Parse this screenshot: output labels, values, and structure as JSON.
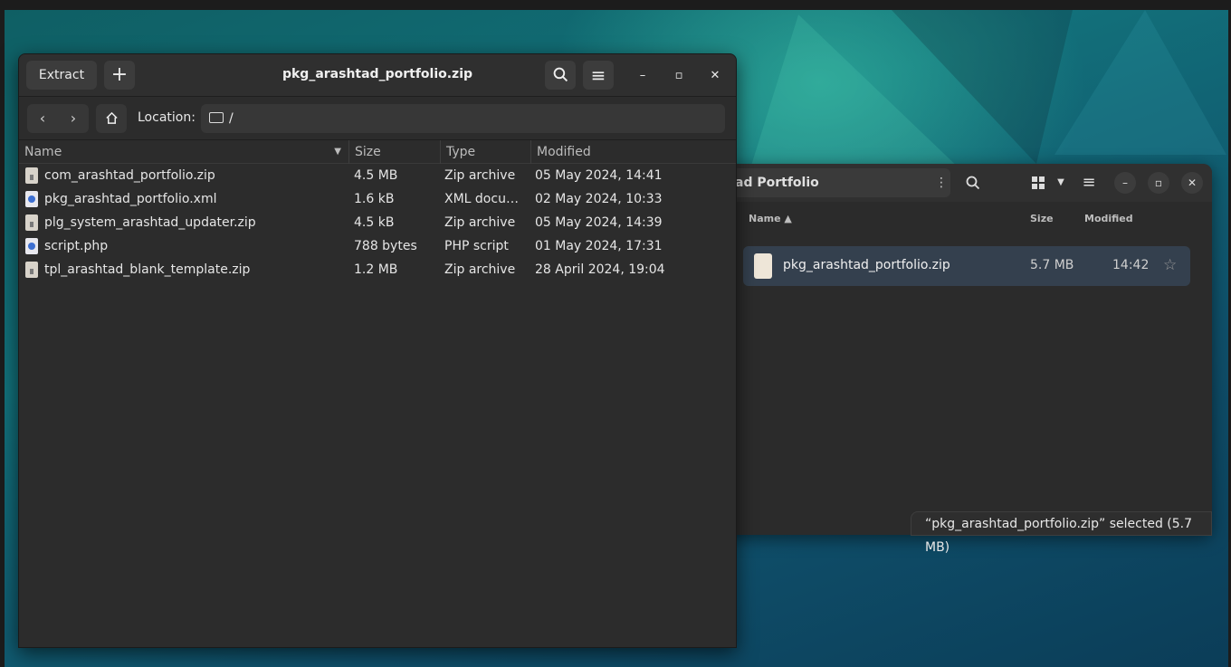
{
  "archive_window": {
    "title": "pkg_arashtad_portfolio.zip",
    "extract_label": "Extract",
    "add_symbol": "+",
    "location_label": "Location:",
    "location_path": "/",
    "columns": {
      "name": "Name",
      "size": "Size",
      "type": "Type",
      "modified": "Modified"
    },
    "files": [
      {
        "icon": "zip",
        "name": "com_arashtad_portfolio.zip",
        "size": "4.5 MB",
        "type": "Zip archive",
        "modified": "05 May 2024, 14:41"
      },
      {
        "icon": "xml",
        "name": "pkg_arashtad_portfolio.xml",
        "size": "1.6 kB",
        "type": "XML docum…",
        "modified": "02 May 2024, 10:33"
      },
      {
        "icon": "zip",
        "name": "plg_system_arashtad_updater.zip",
        "size": "4.5 kB",
        "type": "Zip archive",
        "modified": "05 May 2024, 14:39"
      },
      {
        "icon": "php",
        "name": "script.php",
        "size": "788 bytes",
        "type": "PHP script",
        "modified": "01 May 2024, 17:31"
      },
      {
        "icon": "zip",
        "name": "tpl_arashtad_blank_template.zip",
        "size": "1.2 MB",
        "type": "Zip archive",
        "modified": "28 April 2024, 19:04"
      }
    ]
  },
  "files_window": {
    "path_title": "ad Portfolio",
    "columns": {
      "name": "Name",
      "size": "Size",
      "modified": "Modified"
    },
    "item": {
      "name": "pkg_arashtad_portfolio.zip",
      "size": "5.7 MB",
      "modified": "14:42"
    },
    "status": "“pkg_arashtad_portfolio.zip” selected  (5.7 MB)"
  }
}
